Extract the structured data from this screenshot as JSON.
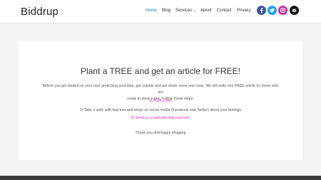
{
  "site": {
    "logo": "Biddrup"
  },
  "nav": {
    "items": [
      "Home",
      "Blog",
      "Services",
      "About",
      "Contact",
      "Privacy"
    ],
    "services_chevron": "⌄",
    "active": "Home"
  },
  "social": {
    "items": [
      {
        "icon": "facebook-icon",
        "color": "#3b5998"
      },
      {
        "icon": "twitter-icon",
        "color": "#1da1f2"
      },
      {
        "icon": "instagram-icon",
        "color": "#d6249f"
      },
      {
        "icon": "email-icon",
        "color": "#111111"
      }
    ]
  },
  "content": {
    "title": "Plant a TREE and get an article for FREE!",
    "intro_line1": "Before you get started on your next great blog post idea, get outside and put down some real roots. We will write one FREE article for those who are",
    "intro_line2": "ready to plant a tree. Follow these steps:",
    "step1": "1) Plant a tree",
    "step2": "2) Take a selfy with that tree and share on social media (Facebook and Twitter) about your feelings",
    "step3": "3) Send us a mail with that post link.",
    "closing": "Thank you and happy blogging"
  },
  "colors": {
    "accent": "#1e73be",
    "link_pink": "#e02bb2",
    "background": "#f4f4f4"
  }
}
